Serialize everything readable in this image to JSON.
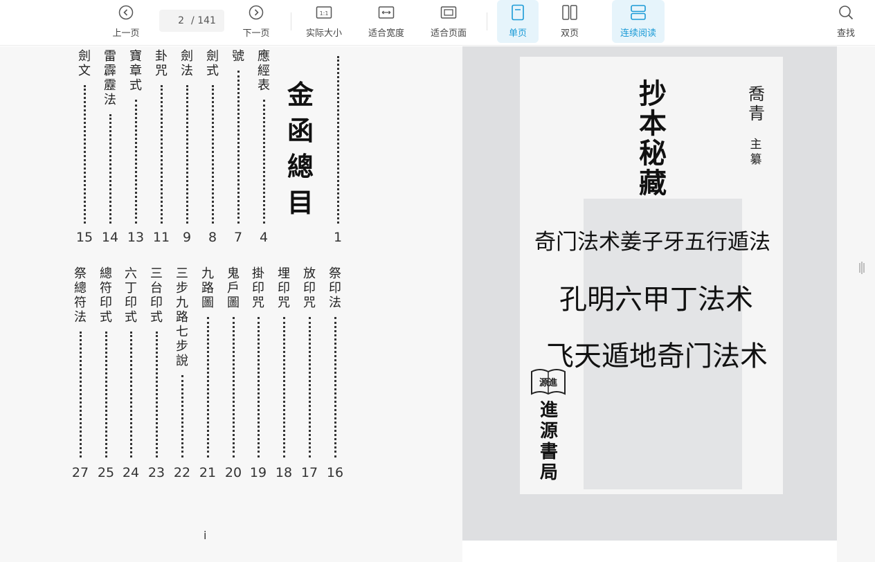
{
  "toolbar": {
    "prev": "上一页",
    "page_current": "2",
    "page_total": "/ 141",
    "next": "下一页",
    "actual_size": "实际大小",
    "fit_width": "适合宽度",
    "fit_page": "适合页面",
    "single_page": "单页",
    "double_page": "双页",
    "continuous": "连续阅读",
    "search": "查找",
    "accent_color": "#1a9ad6",
    "active_bg": "#e6f4fb"
  },
  "toc": {
    "title": "金函總目",
    "top_row": [
      {
        "label": "劍文",
        "page": "15"
      },
      {
        "label": "雷霹靂法",
        "page": "14"
      },
      {
        "label": "寶章式",
        "page": "13"
      },
      {
        "label": "卦咒",
        "page": "11"
      },
      {
        "label": "劍法",
        "page": "9"
      },
      {
        "label": "劍式",
        "page": "8"
      },
      {
        "label": "號",
        "page": "7"
      },
      {
        "label": "應經表",
        "page": "4"
      },
      {
        "label": "",
        "page": "1"
      }
    ],
    "bottom_row": [
      {
        "label": "祭總符法",
        "page": "27"
      },
      {
        "label": "總符印式",
        "page": "25"
      },
      {
        "label": "六丁印式",
        "page": "24"
      },
      {
        "label": "三台印式",
        "page": "23"
      },
      {
        "label": "三步九路七步說",
        "page": "22"
      },
      {
        "label": "九路圖",
        "page": "21"
      },
      {
        "label": "鬼戶圖",
        "page": "20"
      },
      {
        "label": "掛印咒",
        "page": "19"
      },
      {
        "label": "埋印咒",
        "page": "18"
      },
      {
        "label": "放印咒",
        "page": "17"
      },
      {
        "label": "祭印法",
        "page": "16"
      }
    ],
    "roman_page": "i"
  },
  "cover": {
    "title": "抄本秘藏",
    "author": "喬青",
    "editor": "主纂",
    "line1": "奇门法术姜子牙五行遁法",
    "line2": "孔明六甲丁法术",
    "line3": "飞天遁地奇门法术",
    "logo_text": "源進",
    "publisher": "進源書局"
  }
}
